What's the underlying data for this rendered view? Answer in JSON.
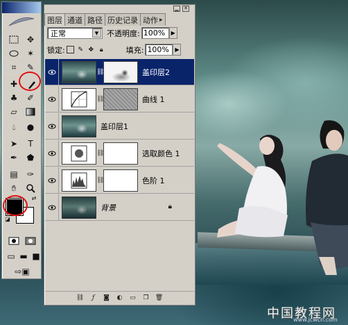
{
  "tabs": [
    {
      "label": "图层"
    },
    {
      "label": "通道"
    },
    {
      "label": "路径"
    },
    {
      "label": "历史记录"
    },
    {
      "label": "动作"
    }
  ],
  "blend_mode": "正常",
  "opacity_label": "不透明度:",
  "opacity_value": "100%",
  "lock_label": "锁定:",
  "fill_label": "填充:",
  "fill_value": "100%",
  "layers": [
    {
      "name": "盖印层2",
      "selected": true
    },
    {
      "name": "曲线 1"
    },
    {
      "name": "盖印层1"
    },
    {
      "name": "选取颜色 1"
    },
    {
      "name": "色阶 1"
    },
    {
      "name": "背景"
    }
  ],
  "watermark": {
    "title": "中国教程网",
    "url": "www.jcwcn.com"
  },
  "colors": {
    "selection": "#0a246a",
    "panel": "#d4d0c8",
    "highlight_ring": "#e01010"
  },
  "icons": [
    "brush-icon",
    "eye-icon",
    "chain-link-icon",
    "lock-icon"
  ]
}
